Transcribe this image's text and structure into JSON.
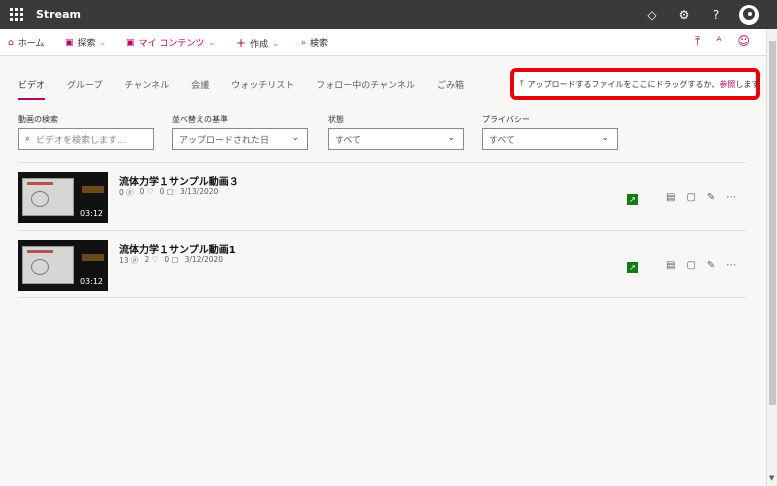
{
  "topbar": {
    "app_name": "Stream",
    "icons": [
      "bell-icon",
      "gear-icon",
      "help-icon",
      "avatar"
    ]
  },
  "nav": {
    "home": "ホーム",
    "explore": "探索",
    "mycontent": "マイ コンテンツ",
    "create": "作成",
    "search": "検索"
  },
  "tabs": [
    {
      "label": "ビデオ"
    },
    {
      "label": "グループ"
    },
    {
      "label": "チャンネル"
    },
    {
      "label": "会議"
    },
    {
      "label": "ウォッチリスト"
    },
    {
      "label": "フォロー中のチャンネル"
    },
    {
      "label": "ごみ箱"
    }
  ],
  "upload": {
    "text": "アップロードするファイルをここにドラッグするか、",
    "link": "参照",
    "suffix": "します"
  },
  "filters": {
    "search_label": "動画の検索",
    "search_placeholder": "ビデオを検索します...",
    "sort_label": "並べ替えの基準",
    "sort_value": "アップロードされた日",
    "state_label": "状態",
    "state_value": "すべて",
    "privacy_label": "プライバシー",
    "privacy_value": "すべて"
  },
  "videos": [
    {
      "title": "流体力学１サンプル動画３",
      "views": "0",
      "likes": "0",
      "comments": "0",
      "date": "3/13/2020",
      "duration": "03:12"
    },
    {
      "title": "流体力学１サンプル動画1",
      "views": "13",
      "likes": "2",
      "comments": "0",
      "date": "3/12/2020",
      "duration": "03:12"
    }
  ],
  "colors": {
    "accent": "#b4006a",
    "topbar": "#3b3a39",
    "highlight": "#e8000b",
    "status": "#107c10"
  }
}
